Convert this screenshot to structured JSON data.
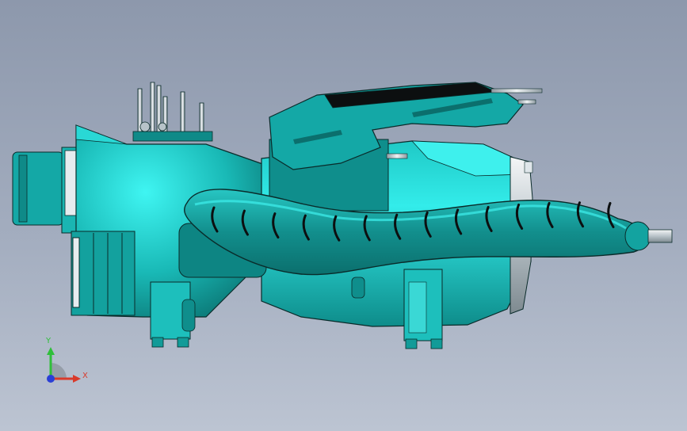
{
  "viewport": {
    "background_top": "#8d98ac",
    "background_bottom": "#bcc4d2"
  },
  "model": {
    "body_color": "#14a8a6",
    "body_highlight": "#33ecea",
    "body_dark": "#0b6f6d",
    "outline_color": "#0a2b2a",
    "black_trim": "#0c0f10",
    "pipe_color": "#c9d3da",
    "duct_rib_count": 14
  },
  "triad": {
    "y_label": "Y",
    "x_label": "X",
    "y_color": "#2fbf3a",
    "x_color": "#d93a2b",
    "z_color": "#2a3fd6"
  }
}
